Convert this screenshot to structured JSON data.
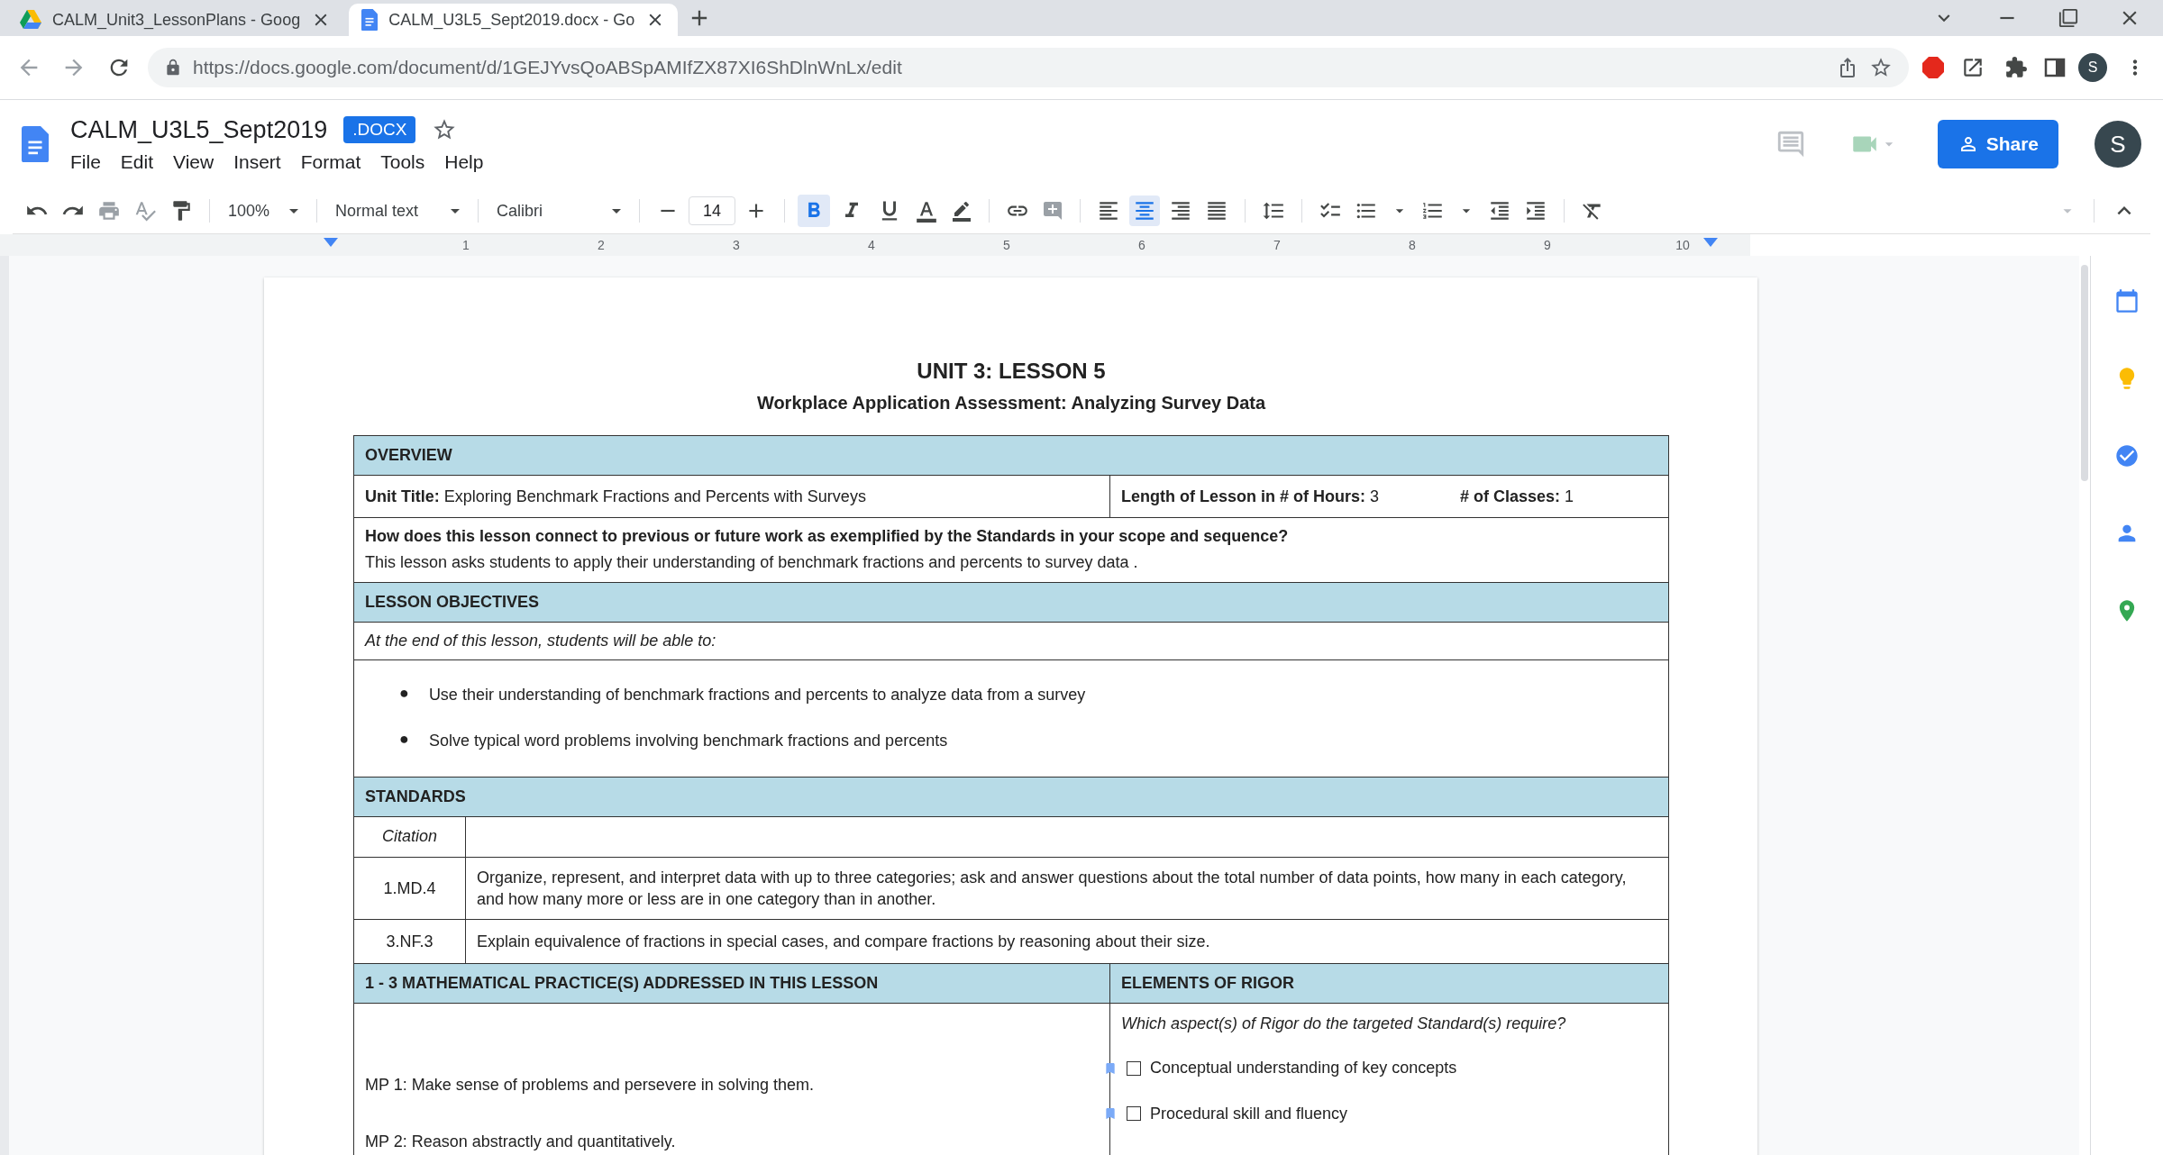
{
  "browser": {
    "tabs": [
      {
        "title": "CALM_Unit3_LessonPlans - Goog",
        "kind": "drive",
        "selected": false
      },
      {
        "title": "CALM_U3L5_Sept2019.docx - Go",
        "kind": "docs",
        "selected": true
      }
    ],
    "url": "https://docs.google.com/document/d/1GEJYvsQoABSpAMIfZX87XI6ShDlnWnLx/edit",
    "profile": "S"
  },
  "docs": {
    "title": "CALM_U3L5_Sept2019",
    "badge": ".DOCX",
    "menu": [
      "File",
      "Edit",
      "View",
      "Insert",
      "Format",
      "Tools",
      "Help"
    ],
    "share": "Share",
    "avatar": "S"
  },
  "toolbar": {
    "zoom": "100%",
    "style": "Normal text",
    "font": "Calibri",
    "font_size": "14",
    "format": [
      {
        "kind": "bold",
        "selected": true
      },
      {
        "kind": "italic",
        "selected": false
      },
      {
        "kind": "underline",
        "selected": false
      }
    ],
    "alignment": [
      {
        "kind": "left",
        "selected": false
      },
      {
        "kind": "center",
        "selected": true
      },
      {
        "kind": "right",
        "selected": false
      },
      {
        "kind": "justify",
        "selected": false
      }
    ]
  },
  "ruler": [
    "1",
    "2",
    "3",
    "4",
    "5",
    "6",
    "7",
    "8",
    "9",
    "10"
  ],
  "document": {
    "heading": "UNIT 3: LESSON 5",
    "subheading": "Workplace Application Assessment: Analyzing Survey Data",
    "overview": {
      "header": "OVERVIEW",
      "unit_title": "**Unit Title:** Exploring Benchmark Fractions and Percents with Surveys",
      "hours": "**Length of Lesson in # of Hours:**  3",
      "classes": "**# of Classes:**  1",
      "question": "How does this lesson connect to previous or future work as exemplified by the Standards in your scope and sequence?",
      "answer": "This lesson asks students to apply their understanding of benchmark fractions and percents to survey data ."
    },
    "objectives": {
      "header": "LESSON OBJECTIVES",
      "intro": "At the end of this lesson, students will be able to:",
      "bullet": "●",
      "items": [
        "Use their understanding of benchmark fractions and percents to analyze data from a survey",
        "Solve typical word problems involving benchmark fractions and percents"
      ]
    },
    "standards": {
      "header": "STANDARDS",
      "citation_label": "Citation",
      "rows": [
        {
          "code": "1.MD.4",
          "text": "Organize, represent, and interpret data with up to three categories; ask and answer questions about the total number of data points, how many in each category, and how many more or less are in one category than in another."
        },
        {
          "code": "3.NF.3",
          "text": "Explain equivalence of fractions in special cases, and compare fractions by reasoning about their size."
        }
      ]
    },
    "practices": {
      "header": "1 - 3 MATHEMATICAL PRACTICE(S) ADDRESSED IN THIS LESSON",
      "items": [
        "MP 1: Make sense of problems and persevere in solving them.",
        "MP 2: Reason abstractly and quantitatively."
      ]
    },
    "rigor": {
      "header": "ELEMENTS OF RIGOR",
      "question": "Which aspect(s) of Rigor do the targeted Standard(s) require?",
      "options": [
        {
          "label": "Conceptual understanding of key concepts",
          "checked": false
        },
        {
          "label": "Procedural skill and fluency",
          "checked": false
        }
      ]
    }
  }
}
